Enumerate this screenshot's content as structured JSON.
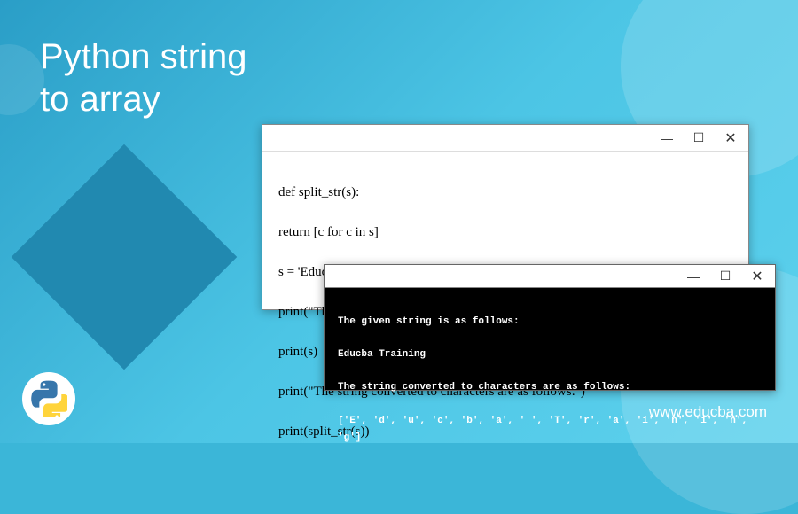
{
  "title": "Python string\nto array",
  "code_window": {
    "line1": "def split_str(s):",
    "line2": "return [c for c in s]",
    "line3": "s = 'Educba Training'",
    "line4": "print(\"The given string is as follows:\")",
    "line5": "print(s)",
    "line6": "print(\"The string converted to characters are as follows:\")",
    "line7": "print(split_str(s))"
  },
  "output_window": {
    "line1": "The given string is as follows:",
    "line2": "Educba Training",
    "line3": "The string converted to characters are as follows:",
    "line4": "['E', 'd', 'u', 'c', 'b', 'a', ' ', 'T', 'r', 'a', 'i', 'n', 'i', 'n', 'g']"
  },
  "controls": {
    "minimize": "—",
    "maximize": "☐",
    "close": "✕"
  },
  "url": "www.educba.com"
}
